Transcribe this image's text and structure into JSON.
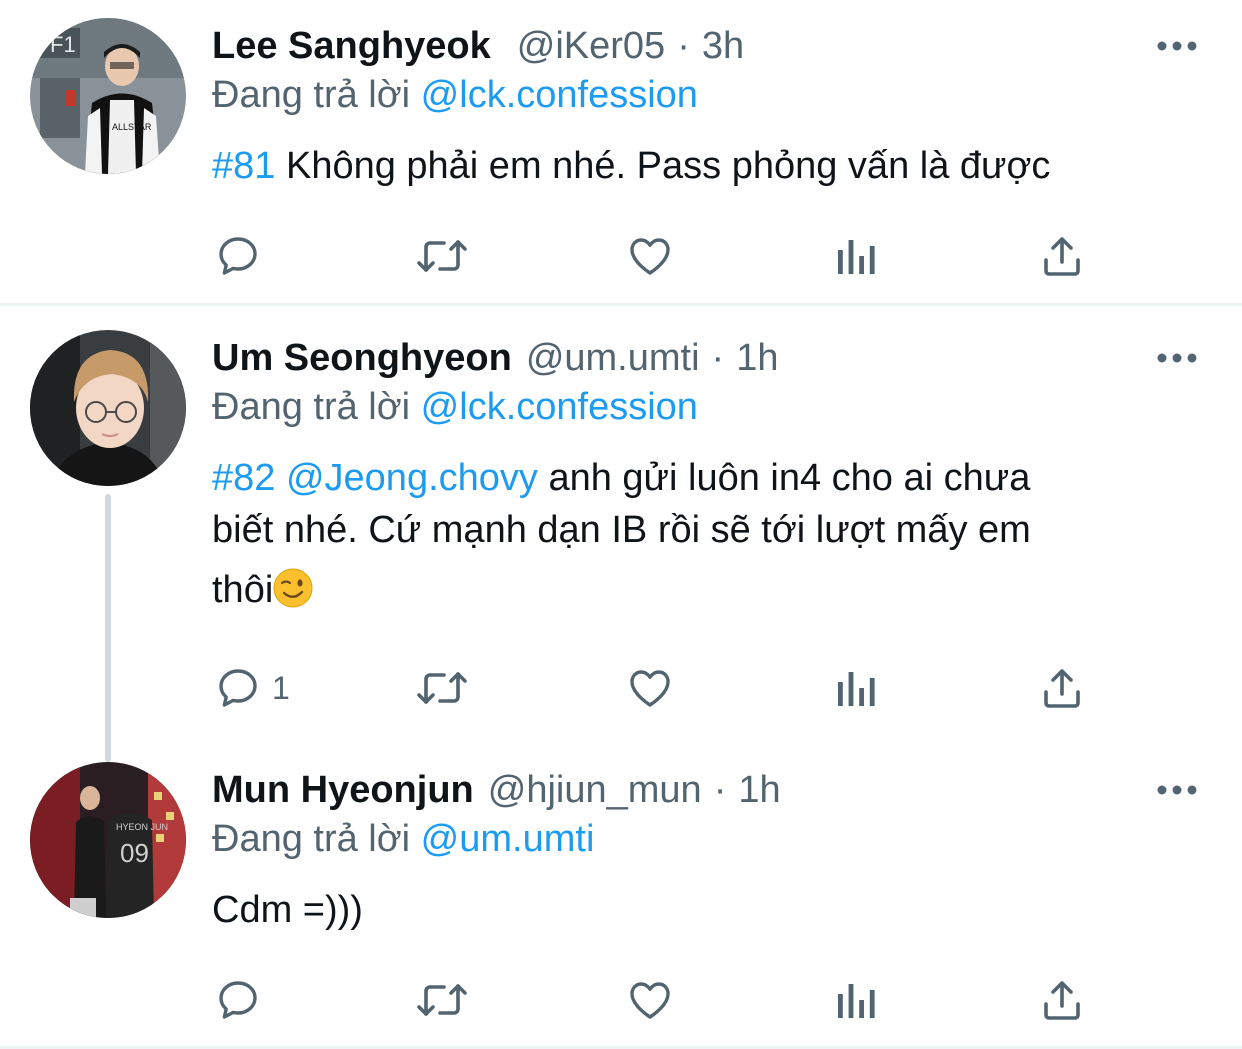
{
  "tweets": [
    {
      "name": "Lee Sanghyeok",
      "handle": "@iKer05",
      "separator": "·",
      "time": "3h",
      "replying_prefix": "Đang trả lời",
      "replying_to": "@lck.confession",
      "hashtag": "#81",
      "text": "Không phải em nhé. Pass phỏng vấn là được",
      "reply_count": ""
    },
    {
      "name": "Um Seonghyeon",
      "handle": "@um.umti",
      "separator": "·",
      "time": "1h",
      "replying_prefix": "Đang trả lời",
      "replying_to": "@lck.confession",
      "hashtag": "#82",
      "mention": "@Jeong.chovy",
      "text_line1": "anh gửi luôn in4 cho ai chưa",
      "text_line2": "biết nhé. Cứ mạnh dạn IB rồi sẽ tới lượt mấy em",
      "text_line3": "thôi",
      "emoji": "winking-face",
      "reply_count": "1"
    },
    {
      "name": "Mun Hyeonjun",
      "handle": "@hjiun_mun",
      "separator": "·",
      "time": "1h",
      "replying_prefix": "Đang trả lời",
      "replying_to": "@um.umti",
      "text": "Cdm =)))",
      "reply_count": ""
    }
  ],
  "icons": {
    "more": "more-options-icon",
    "reply": "reply-icon",
    "retweet": "retweet-icon",
    "like": "heart-icon",
    "views": "views-chart-icon",
    "share": "share-icon"
  },
  "colors": {
    "link": "#1d9bf0",
    "secondary": "#536471",
    "text": "#0f1419",
    "divider": "#eff3f4",
    "thread_line": "#cfd9de"
  }
}
